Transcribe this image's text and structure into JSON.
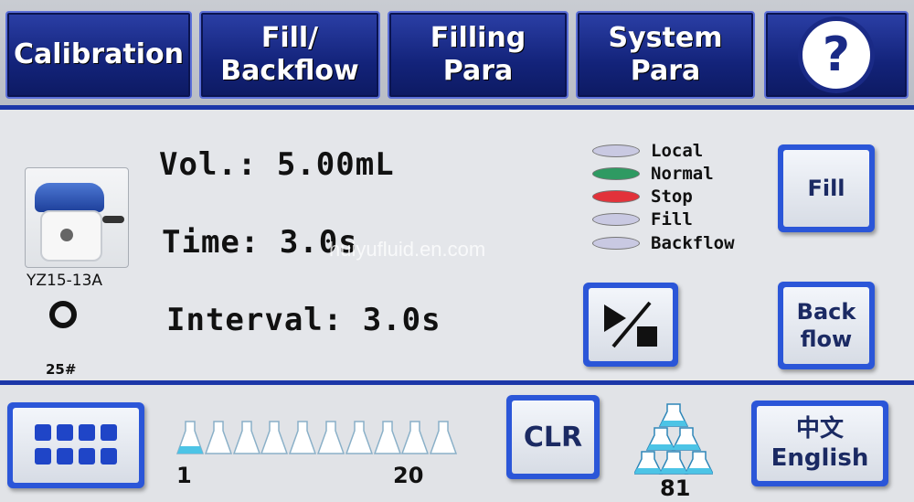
{
  "tabs": [
    {
      "label": "Calibration"
    },
    {
      "label": "Fill/\nBackflow"
    },
    {
      "label": "Filling\nPara"
    },
    {
      "label": "System\nPara"
    }
  ],
  "help": {
    "label": "?"
  },
  "pump": {
    "model": "YZ15-13A",
    "tube_size": "25#"
  },
  "params": {
    "volume": "Vol.: 5.00mL",
    "time": "Time: 3.0s",
    "interval": "Interval: 3.0s"
  },
  "watermark": "huiyufluid.en.com",
  "legend": [
    {
      "label": "Local",
      "color": "#c9c9e2"
    },
    {
      "label": "Normal",
      "color": "#2e9a62"
    },
    {
      "label": "Stop",
      "color": "#e2323a"
    },
    {
      "label": "Fill",
      "color": "#c9c9e2"
    },
    {
      "label": "Backflow",
      "color": "#c9c9e2"
    }
  ],
  "buttons": {
    "fill": "Fill",
    "backflow": "Back\nflow",
    "clr": "CLR",
    "language": "中文\nEnglish"
  },
  "bottom": {
    "flask_start": "1",
    "flask_end": "20",
    "flask_count": 10,
    "flask_filled": 1,
    "stack_count": "81"
  },
  "colors": {
    "tab_bg": "#13237a",
    "divider": "#1c37a8",
    "button_frame": "#2b56d8",
    "flask_fill": "#4cc4e6"
  }
}
